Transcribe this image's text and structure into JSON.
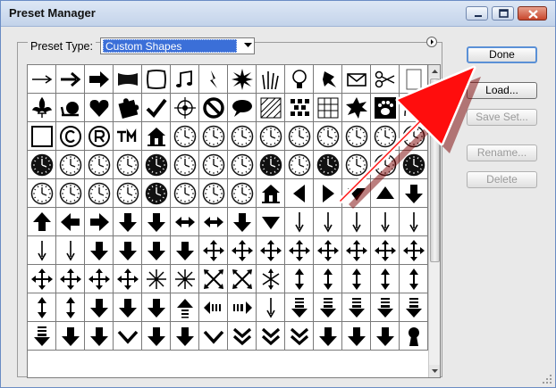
{
  "window": {
    "title": "Preset Manager",
    "controls": [
      "minimize-icon",
      "maximize-icon",
      "close-icon"
    ]
  },
  "preset_type": {
    "label": "Preset Type:",
    "value": "Custom Shapes"
  },
  "buttons": {
    "done": "Done",
    "load": "Load...",
    "save_set": "Save Set...",
    "rename": "Rename...",
    "delete": "Delete"
  },
  "shapes": [
    "arrow-thin-right",
    "arrow-medium-right",
    "arrow-bold-right",
    "banner",
    "frame",
    "music-notes",
    "lightning",
    "starburst",
    "grass",
    "lightbulb",
    "thumbtack",
    "envelope",
    "scissors",
    "blank-tag",
    "fleur-de-lis",
    "snail",
    "heart",
    "puzzle-piece",
    "checkmark",
    "target",
    "no-symbol",
    "speech-bubble",
    "hatch-square",
    "checker-diamond",
    "grid-square",
    "starburst-seal",
    "paw-print",
    "circle-frame",
    "square-frame",
    "copyright",
    "registered",
    "trademark",
    "house",
    "clock",
    "clock",
    "clock",
    "clock",
    "clock",
    "clock",
    "clock",
    "clock",
    "clock",
    "clock-dark",
    "clock",
    "clock",
    "clock",
    "clock-dark",
    "clock",
    "clock",
    "clock",
    "clock-dark",
    "clock",
    "clock-dark",
    "clock",
    "clock",
    "clock-dark",
    "clock",
    "clock",
    "clock",
    "clock",
    "clock-dark",
    "clock",
    "clock",
    "clock",
    "house",
    "triangle-left",
    "triangle-right",
    "triangle-down",
    "triangle-up",
    "arrow-down-bold",
    "arrow-up-bold",
    "arrow-left-bold",
    "arrow-right-bold",
    "arrow-down-bold",
    "arrow-down-bold",
    "arrow-left-right",
    "arrow-left-right",
    "arrow-down-bold",
    "triangle-down",
    "arrow-down-thin",
    "arrow-down-thin",
    "arrow-down-thin",
    "arrow-down-thin",
    "arrow-down-thin",
    "arrow-down-thin",
    "arrow-down-thin",
    "arrow-down-bold",
    "arrow-down-bold",
    "arrow-down-bold",
    "arrow-down-bold",
    "four-way-arrows",
    "four-way-arrows",
    "four-way-arrows",
    "four-way-arrows",
    "four-way-arrows",
    "four-way-arrows",
    "four-way-arrows",
    "four-way-arrows",
    "four-way-arrows",
    "four-way-arrows",
    "four-way-arrows",
    "four-way-arrows",
    "starburst-arrows",
    "starburst-arrows",
    "x-arrows",
    "x-arrows",
    "compass-arrows",
    "double-arrow-vertical",
    "double-arrow-vertical",
    "double-arrow-vertical",
    "double-arrow-vertical",
    "double-arrow-vertical",
    "double-arrow-vertical",
    "double-arrow-vertical",
    "arrow-down-bold",
    "arrow-down-bold",
    "arrow-down-bold",
    "striped-arrow-up",
    "striped-arrow-left-right",
    "striped-arrow-right",
    "arrow-down-thin",
    "striped-arrow-down",
    "striped-arrow-down",
    "striped-arrow-down",
    "striped-arrow-down",
    "striped-arrow-down",
    "striped-arrow-down",
    "arrow-down-bold",
    "arrow-down-bold",
    "chevron-down",
    "arrow-down-bold",
    "arrow-down-bold",
    "chevron-down",
    "double-chevron-down",
    "double-chevron-down",
    "double-chevron-down",
    "arrow-down-bold",
    "arrow-down-bold",
    "arrow-down-bold",
    "keyhole"
  ]
}
